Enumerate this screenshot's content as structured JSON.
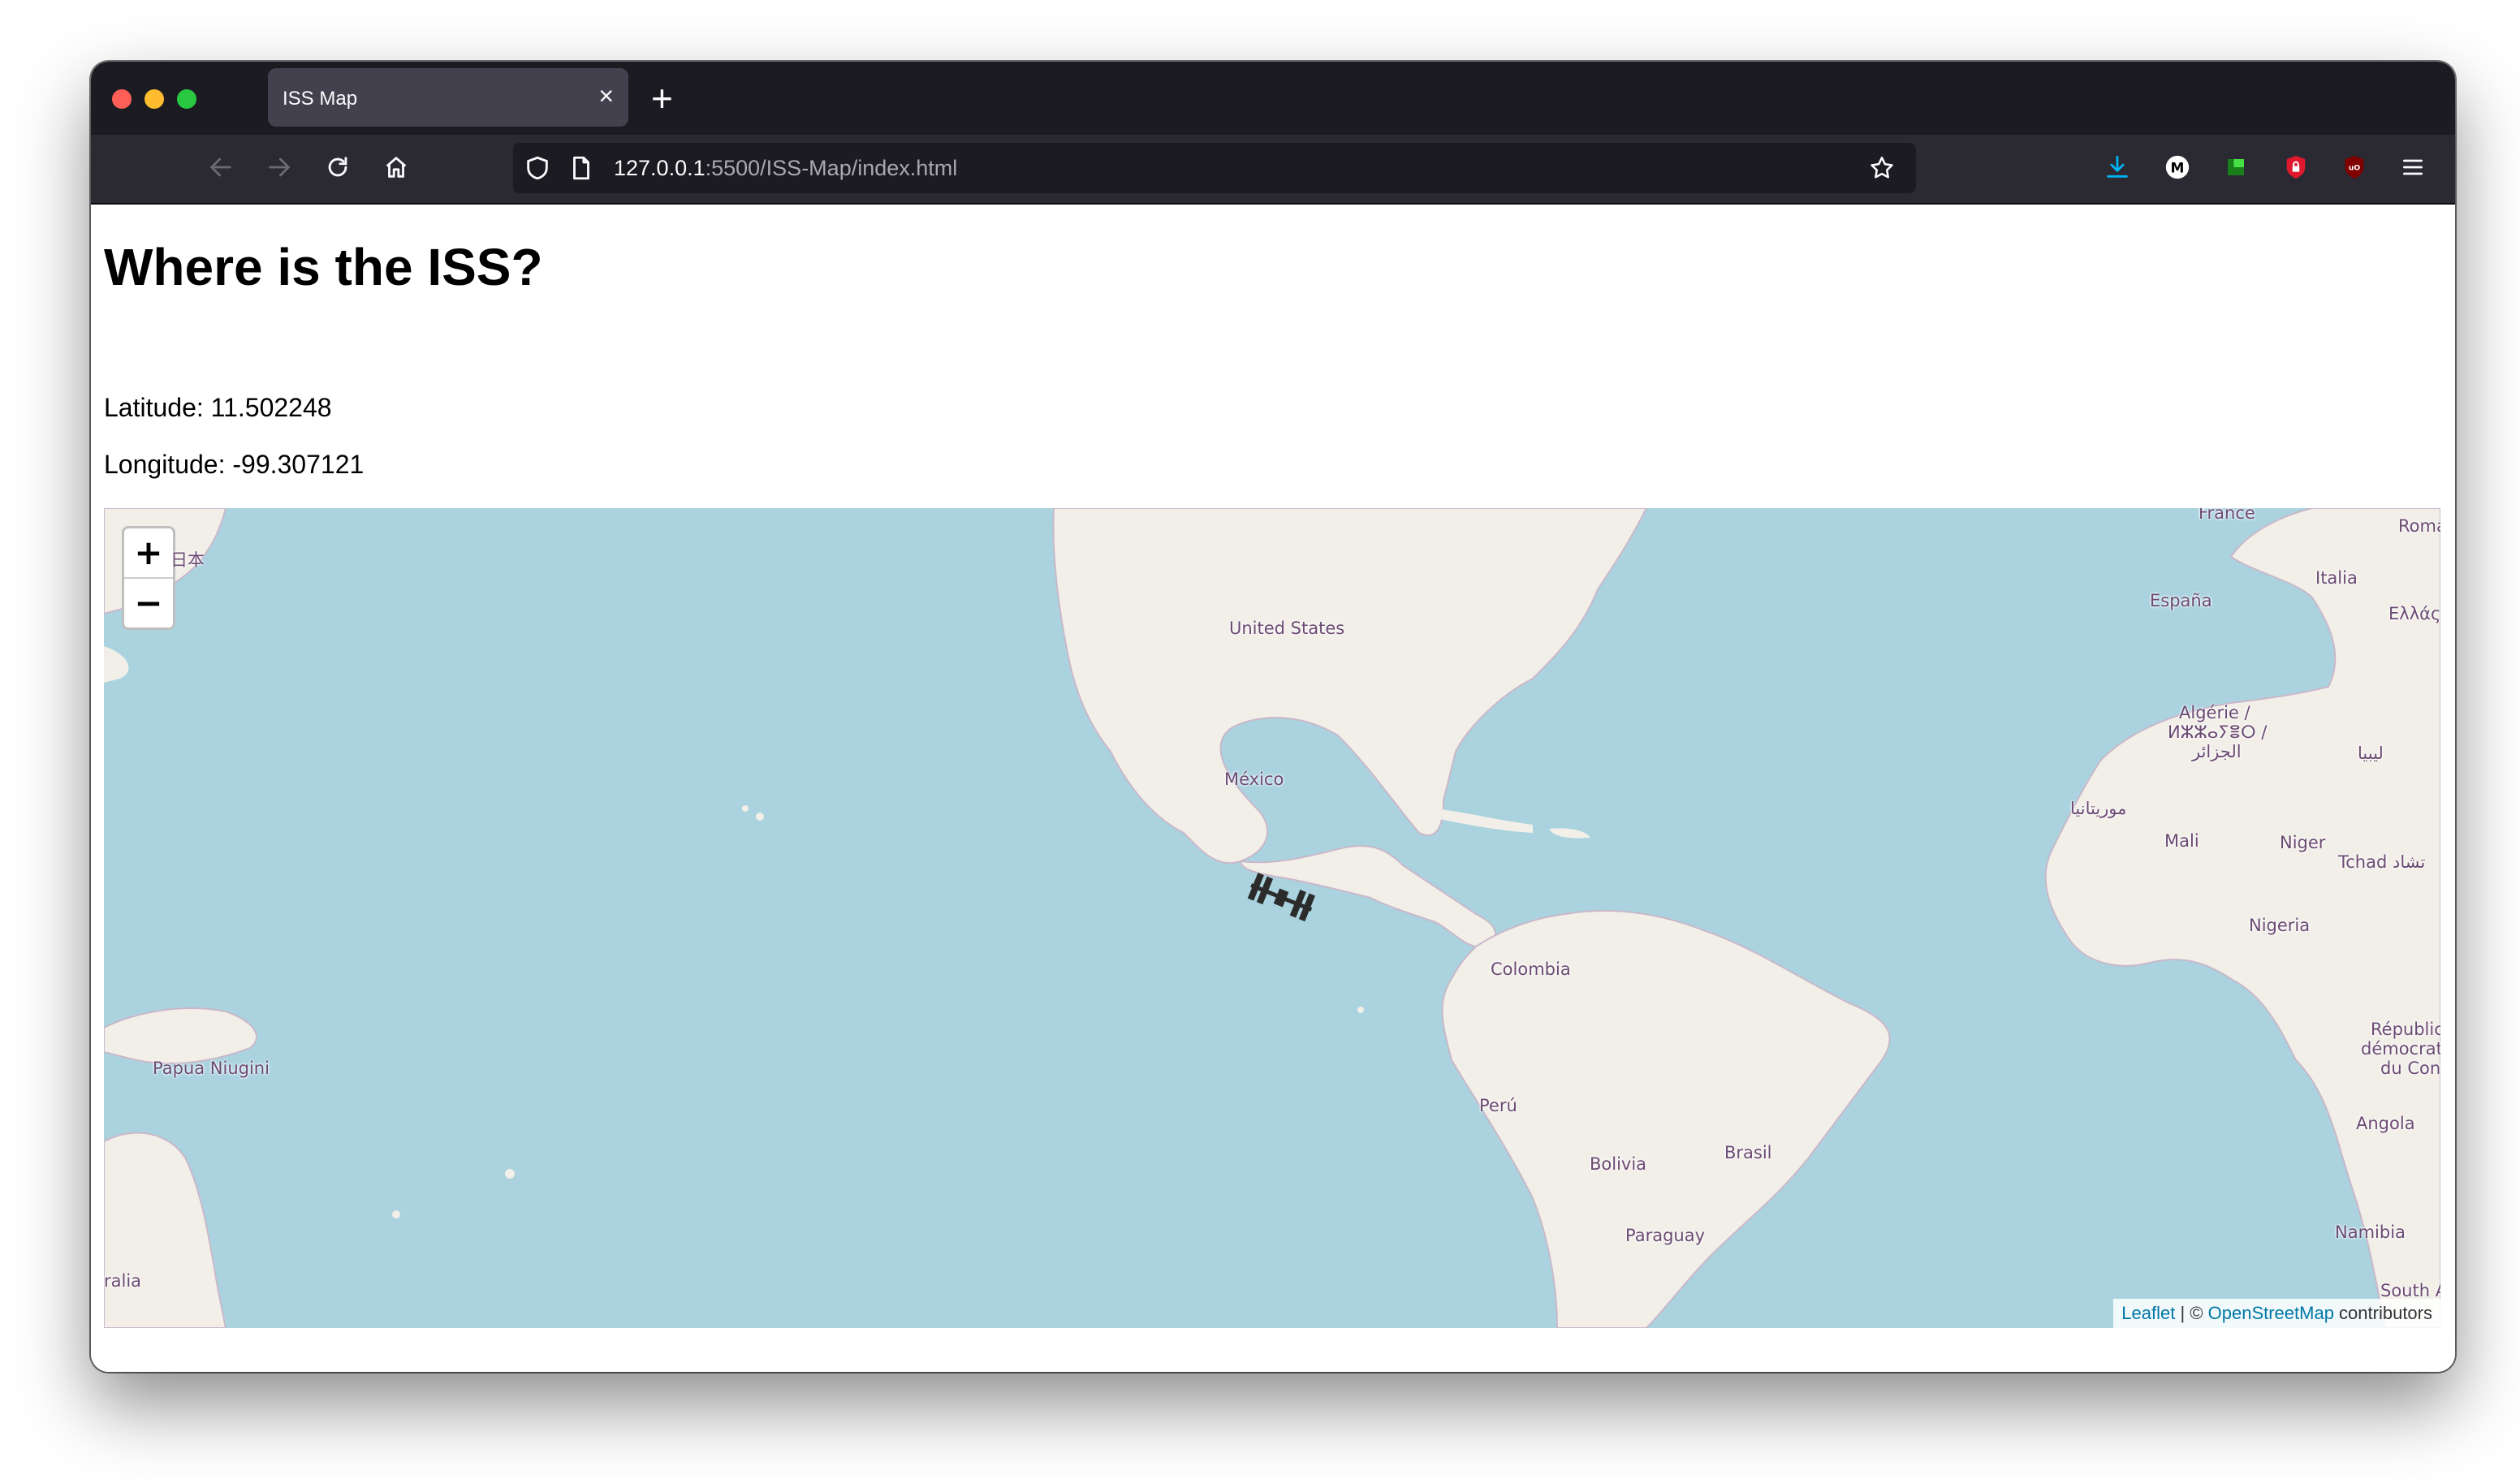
{
  "browser": {
    "tab_title": "ISS Map",
    "url_host": "127.0.0.1",
    "url_rest": ":5500/ISS-Map/index.html"
  },
  "page": {
    "heading": "Where is the ISS?",
    "latitude_text": "Latitude: 11.502248",
    "longitude_text": "Longitude: -99.307121"
  },
  "map": {
    "zoom_in": "+",
    "zoom_out": "−",
    "attribution_leaflet": "Leaflet",
    "attribution_sep": " | © ",
    "attribution_osm": "OpenStreetMap",
    "attribution_tail": " contributors",
    "labels": {
      "japan": "日本",
      "united_states": "United States",
      "mexico": "México",
      "colombia": "Colombia",
      "peru": "Perú",
      "bolivia": "Bolivia",
      "brasil": "Brasil",
      "paraguay": "Paraguay",
      "papua": "Papua Niugini",
      "australia": "ralia",
      "france": "France",
      "roma": "Roma",
      "espana": "España",
      "italia": "Italia",
      "greece": "Ελλάς",
      "algerie1": "Algérie /",
      "algerie2": "ⵍⵣⵣⴰⵢⴻⵔ /",
      "algerie3": "الجزائر",
      "libya": "ليبيا",
      "mauritania": "موريتانيا",
      "mali": "Mali",
      "niger": "Niger",
      "tchad": "Tchad تشاد",
      "nigeria": "Nigeria",
      "drc1": "Républic",
      "drc2": "démocrat",
      "drc3": "du Con",
      "angola": "Angola",
      "namibia": "Namibia",
      "south_africa": "South A"
    }
  }
}
